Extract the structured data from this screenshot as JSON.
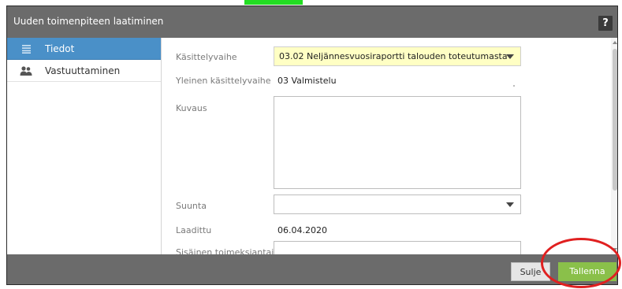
{
  "dialog": {
    "title": "Uuden toimenpiteen laatiminen",
    "help_label": "?"
  },
  "sidebar": {
    "items": [
      {
        "label": "Tiedot",
        "icon": "list-icon",
        "active": true
      },
      {
        "label": "Vastuuttaminen",
        "icon": "users-icon",
        "active": false
      }
    ]
  },
  "form": {
    "kasittelyvaihe": {
      "label": "Käsittelyvaihe",
      "value": "03.02 Neljännesvuosiraportti talouden toteutumasta"
    },
    "yleinen": {
      "label": "Yleinen käsittelyvaihe",
      "value": "03 Valmistelu"
    },
    "kuvaus": {
      "label": "Kuvaus",
      "value": ""
    },
    "suunta": {
      "label": "Suunta",
      "value": ""
    },
    "laadittu": {
      "label": "Laadittu",
      "value": "06.04.2020"
    },
    "sisainen": {
      "label": "Sisäinen toimeksiantaja",
      "value": ""
    }
  },
  "footer": {
    "close_label": "Sulje",
    "save_label": "Tallenna"
  },
  "colors": {
    "header_bg": "#6b6b6b",
    "active_tab": "#4a90c8",
    "save_button": "#8ac04a",
    "select_highlight": "#ffffc4",
    "annotation_red": "#e02020",
    "annotation_green": "#22dd22"
  }
}
